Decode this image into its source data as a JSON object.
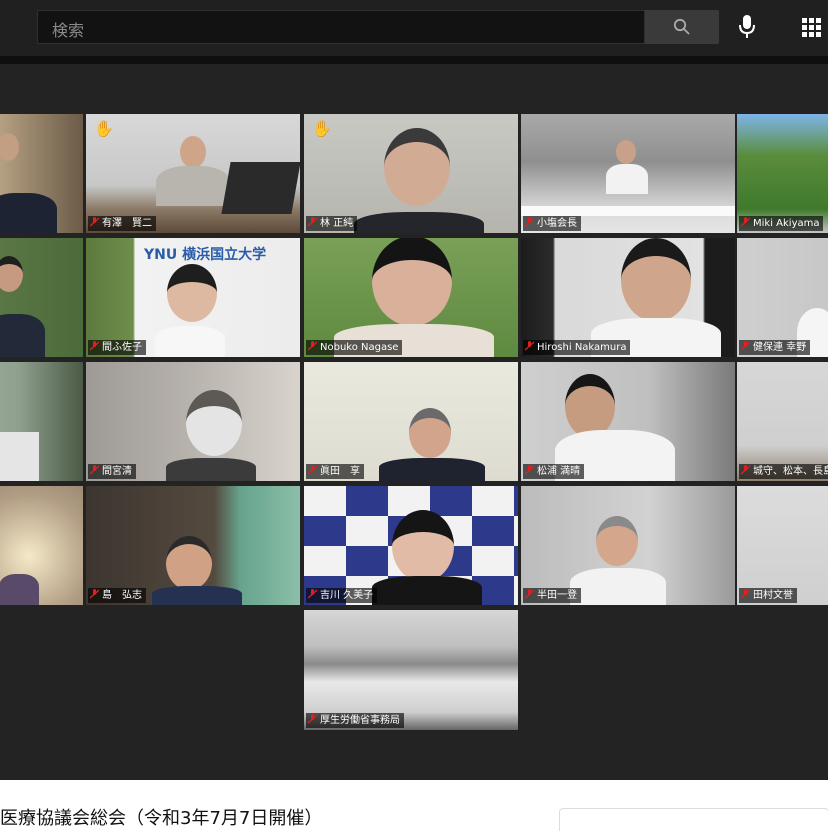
{
  "search": {
    "placeholder": "検索"
  },
  "icons": {
    "search": "search-icon",
    "mic": "microphone-icon",
    "apps": "apps-grid-icon"
  },
  "participants": [
    {
      "name": ""
    },
    {
      "name": "有澤　賢二"
    },
    {
      "name": "林 正純"
    },
    {
      "name": "小塩会長"
    },
    {
      "name": "Miki Akiyama"
    },
    {
      "name": ""
    },
    {
      "name": "間ふ佐子"
    },
    {
      "name": "Nobuko Nagase"
    },
    {
      "name": "Hiroshi Nakamura"
    },
    {
      "name": "健保連 幸野"
    },
    {
      "name": ""
    },
    {
      "name": "間宮清"
    },
    {
      "name": "眞田　享"
    },
    {
      "name": "松浦 満晴"
    },
    {
      "name": "城守、松本、長島"
    },
    {
      "name": ""
    },
    {
      "name": "島　弘志"
    },
    {
      "name": "吉川 久美子"
    },
    {
      "name": "半田一登"
    },
    {
      "name": "田村文誉"
    },
    {
      "name": "厚生労働省事務局"
    }
  ],
  "sign_text": "YNU 横浜国立大学",
  "video_title": "医療協議会総会（令和3年7月7日開催）",
  "colors": {
    "active_border": "#c5e06a",
    "hand": "#f5c000",
    "mute": "#e02020"
  }
}
